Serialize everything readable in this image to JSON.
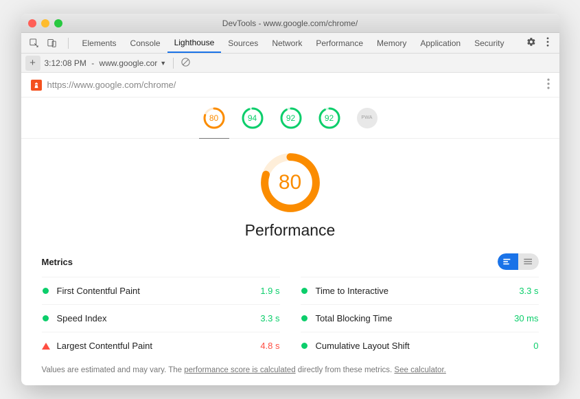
{
  "window_title": "DevTools - www.google.com/chrome/",
  "tabs": [
    "Elements",
    "Console",
    "Lighthouse",
    "Sources",
    "Network",
    "Performance",
    "Memory",
    "Application",
    "Security"
  ],
  "active_tab": "Lighthouse",
  "subbar": {
    "time": "3:12:08 PM",
    "host": "www.google.cor"
  },
  "url": "https://www.google.com/chrome/",
  "nav": [
    {
      "score": 80,
      "color": "#fb8c00"
    },
    {
      "score": 94,
      "color": "#0cce6b"
    },
    {
      "score": 92,
      "color": "#0cce6b"
    },
    {
      "score": 92,
      "color": "#0cce6b"
    }
  ],
  "pwa_label": "PWA",
  "main": {
    "score": 80,
    "color": "#fb8c00",
    "category": "Performance"
  },
  "metrics_heading": "Metrics",
  "metrics": [
    {
      "name": "First Contentful Paint",
      "value": "1.9 s",
      "status": "pass",
      "color": "#0cce6b"
    },
    {
      "name": "Time to Interactive",
      "value": "3.3 s",
      "status": "pass",
      "color": "#0cce6b"
    },
    {
      "name": "Speed Index",
      "value": "3.3 s",
      "status": "pass",
      "color": "#0cce6b"
    },
    {
      "name": "Total Blocking Time",
      "value": "30 ms",
      "status": "pass",
      "color": "#0cce6b"
    },
    {
      "name": "Largest Contentful Paint",
      "value": "4.8 s",
      "status": "fail",
      "color": "#ff4e42"
    },
    {
      "name": "Cumulative Layout Shift",
      "value": "0",
      "status": "pass",
      "color": "#0cce6b"
    }
  ],
  "footer": {
    "prefix": "Values are estimated and may vary. The ",
    "link1": "performance score is calculated",
    "mid": " directly from these metrics. ",
    "link2": "See calculator."
  }
}
